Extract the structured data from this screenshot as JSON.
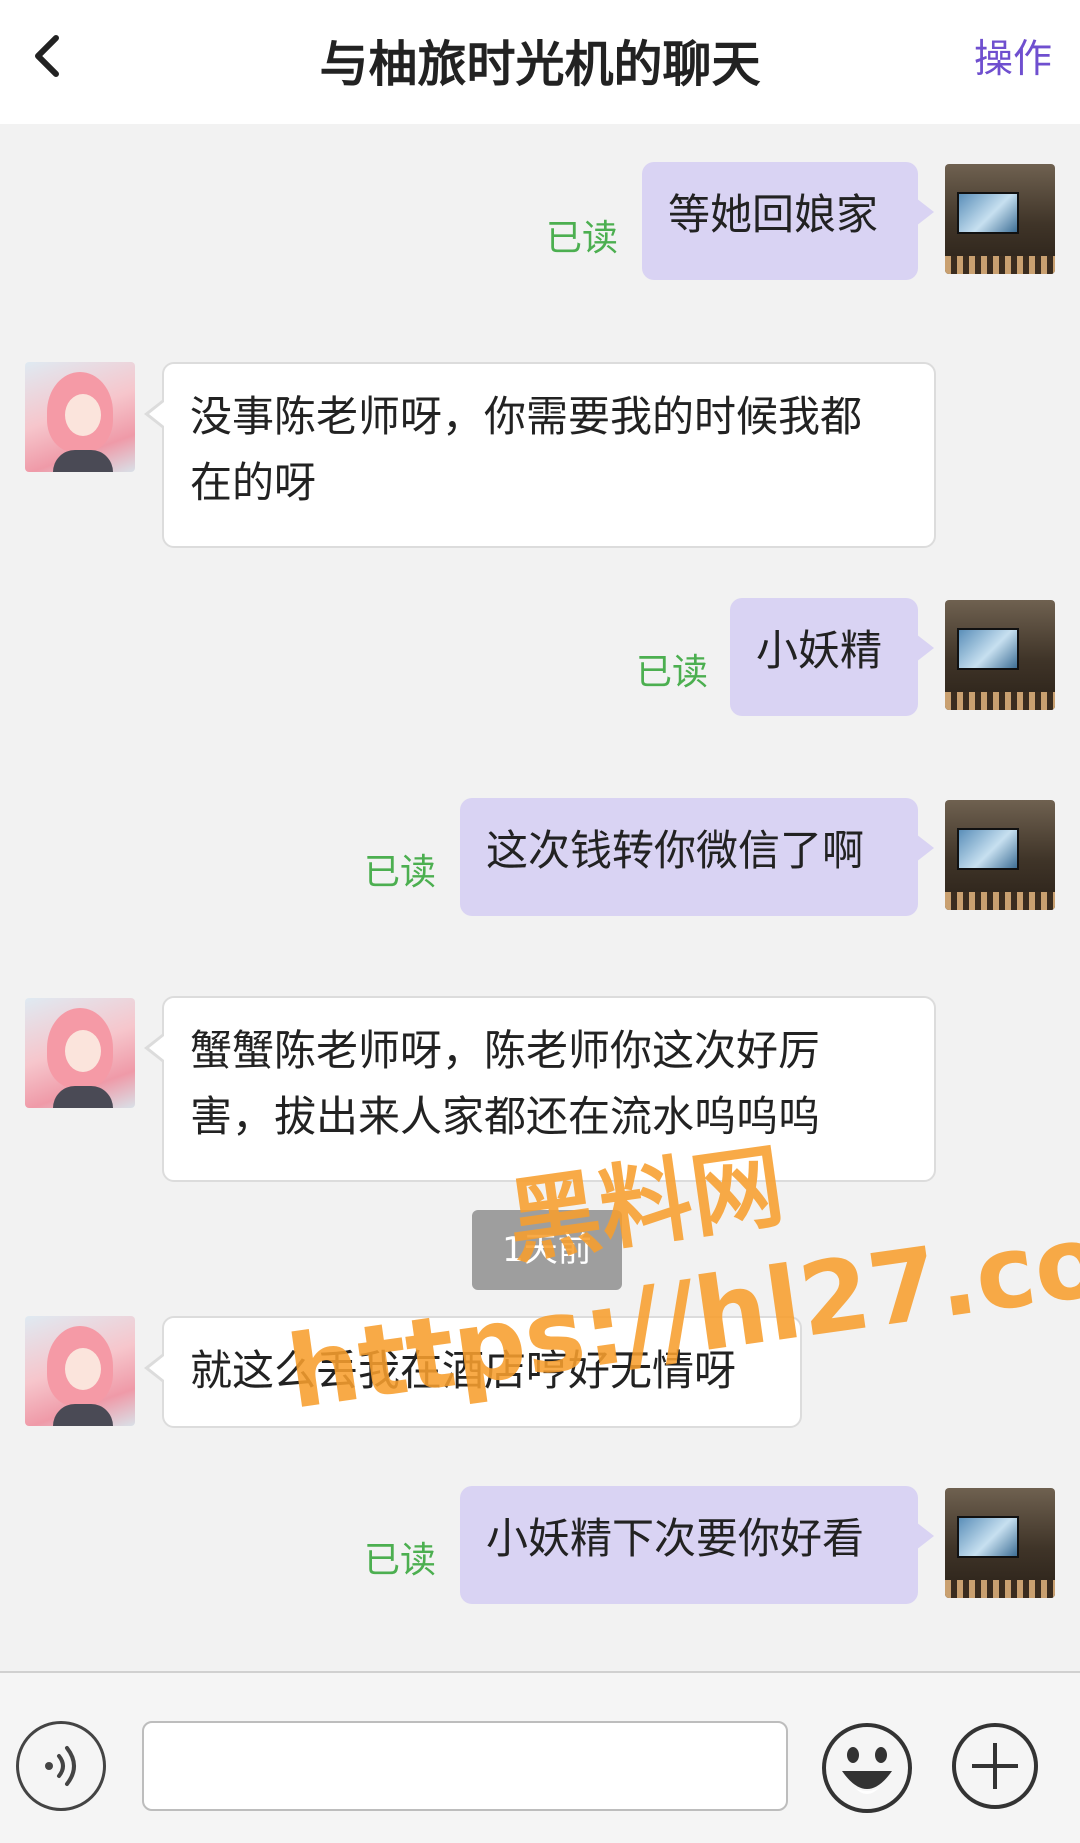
{
  "header": {
    "title": "与柚旅时光机的聊天",
    "action_label": "操作"
  },
  "messages": [
    {
      "side": "self",
      "text": "等她回娘家",
      "read": "已读"
    },
    {
      "side": "other",
      "line1": "没事陈老师呀，你需要我的时候我都",
      "line2": "在的呀"
    },
    {
      "side": "self",
      "text": "小妖精",
      "read": "已读"
    },
    {
      "side": "self",
      "text": "这次钱转你微信了啊",
      "read": "已读"
    },
    {
      "side": "other",
      "line1": "蟹蟹陈老师呀，陈老师你这次好厉",
      "line2": "害，拔出来人家都还在流水呜呜呜"
    },
    {
      "side": "other",
      "text": "就这么丢我在酒店哼好无情呀"
    },
    {
      "side": "self",
      "text": "小妖精下次要你好看",
      "read": "已读"
    }
  ],
  "timestamp": "1天前",
  "watermark": {
    "line1": "黑料网",
    "line2": "https://hl27.co"
  },
  "composer": {
    "input_value": "",
    "input_placeholder": ""
  },
  "colors": {
    "accent": "#6f4fcf",
    "self_bubble": "#d9d3f3",
    "read_status": "#4caf50",
    "watermark": "#f79e2e"
  },
  "icons": [
    "back-icon",
    "voice-icon",
    "emoji-icon",
    "plus-icon"
  ]
}
